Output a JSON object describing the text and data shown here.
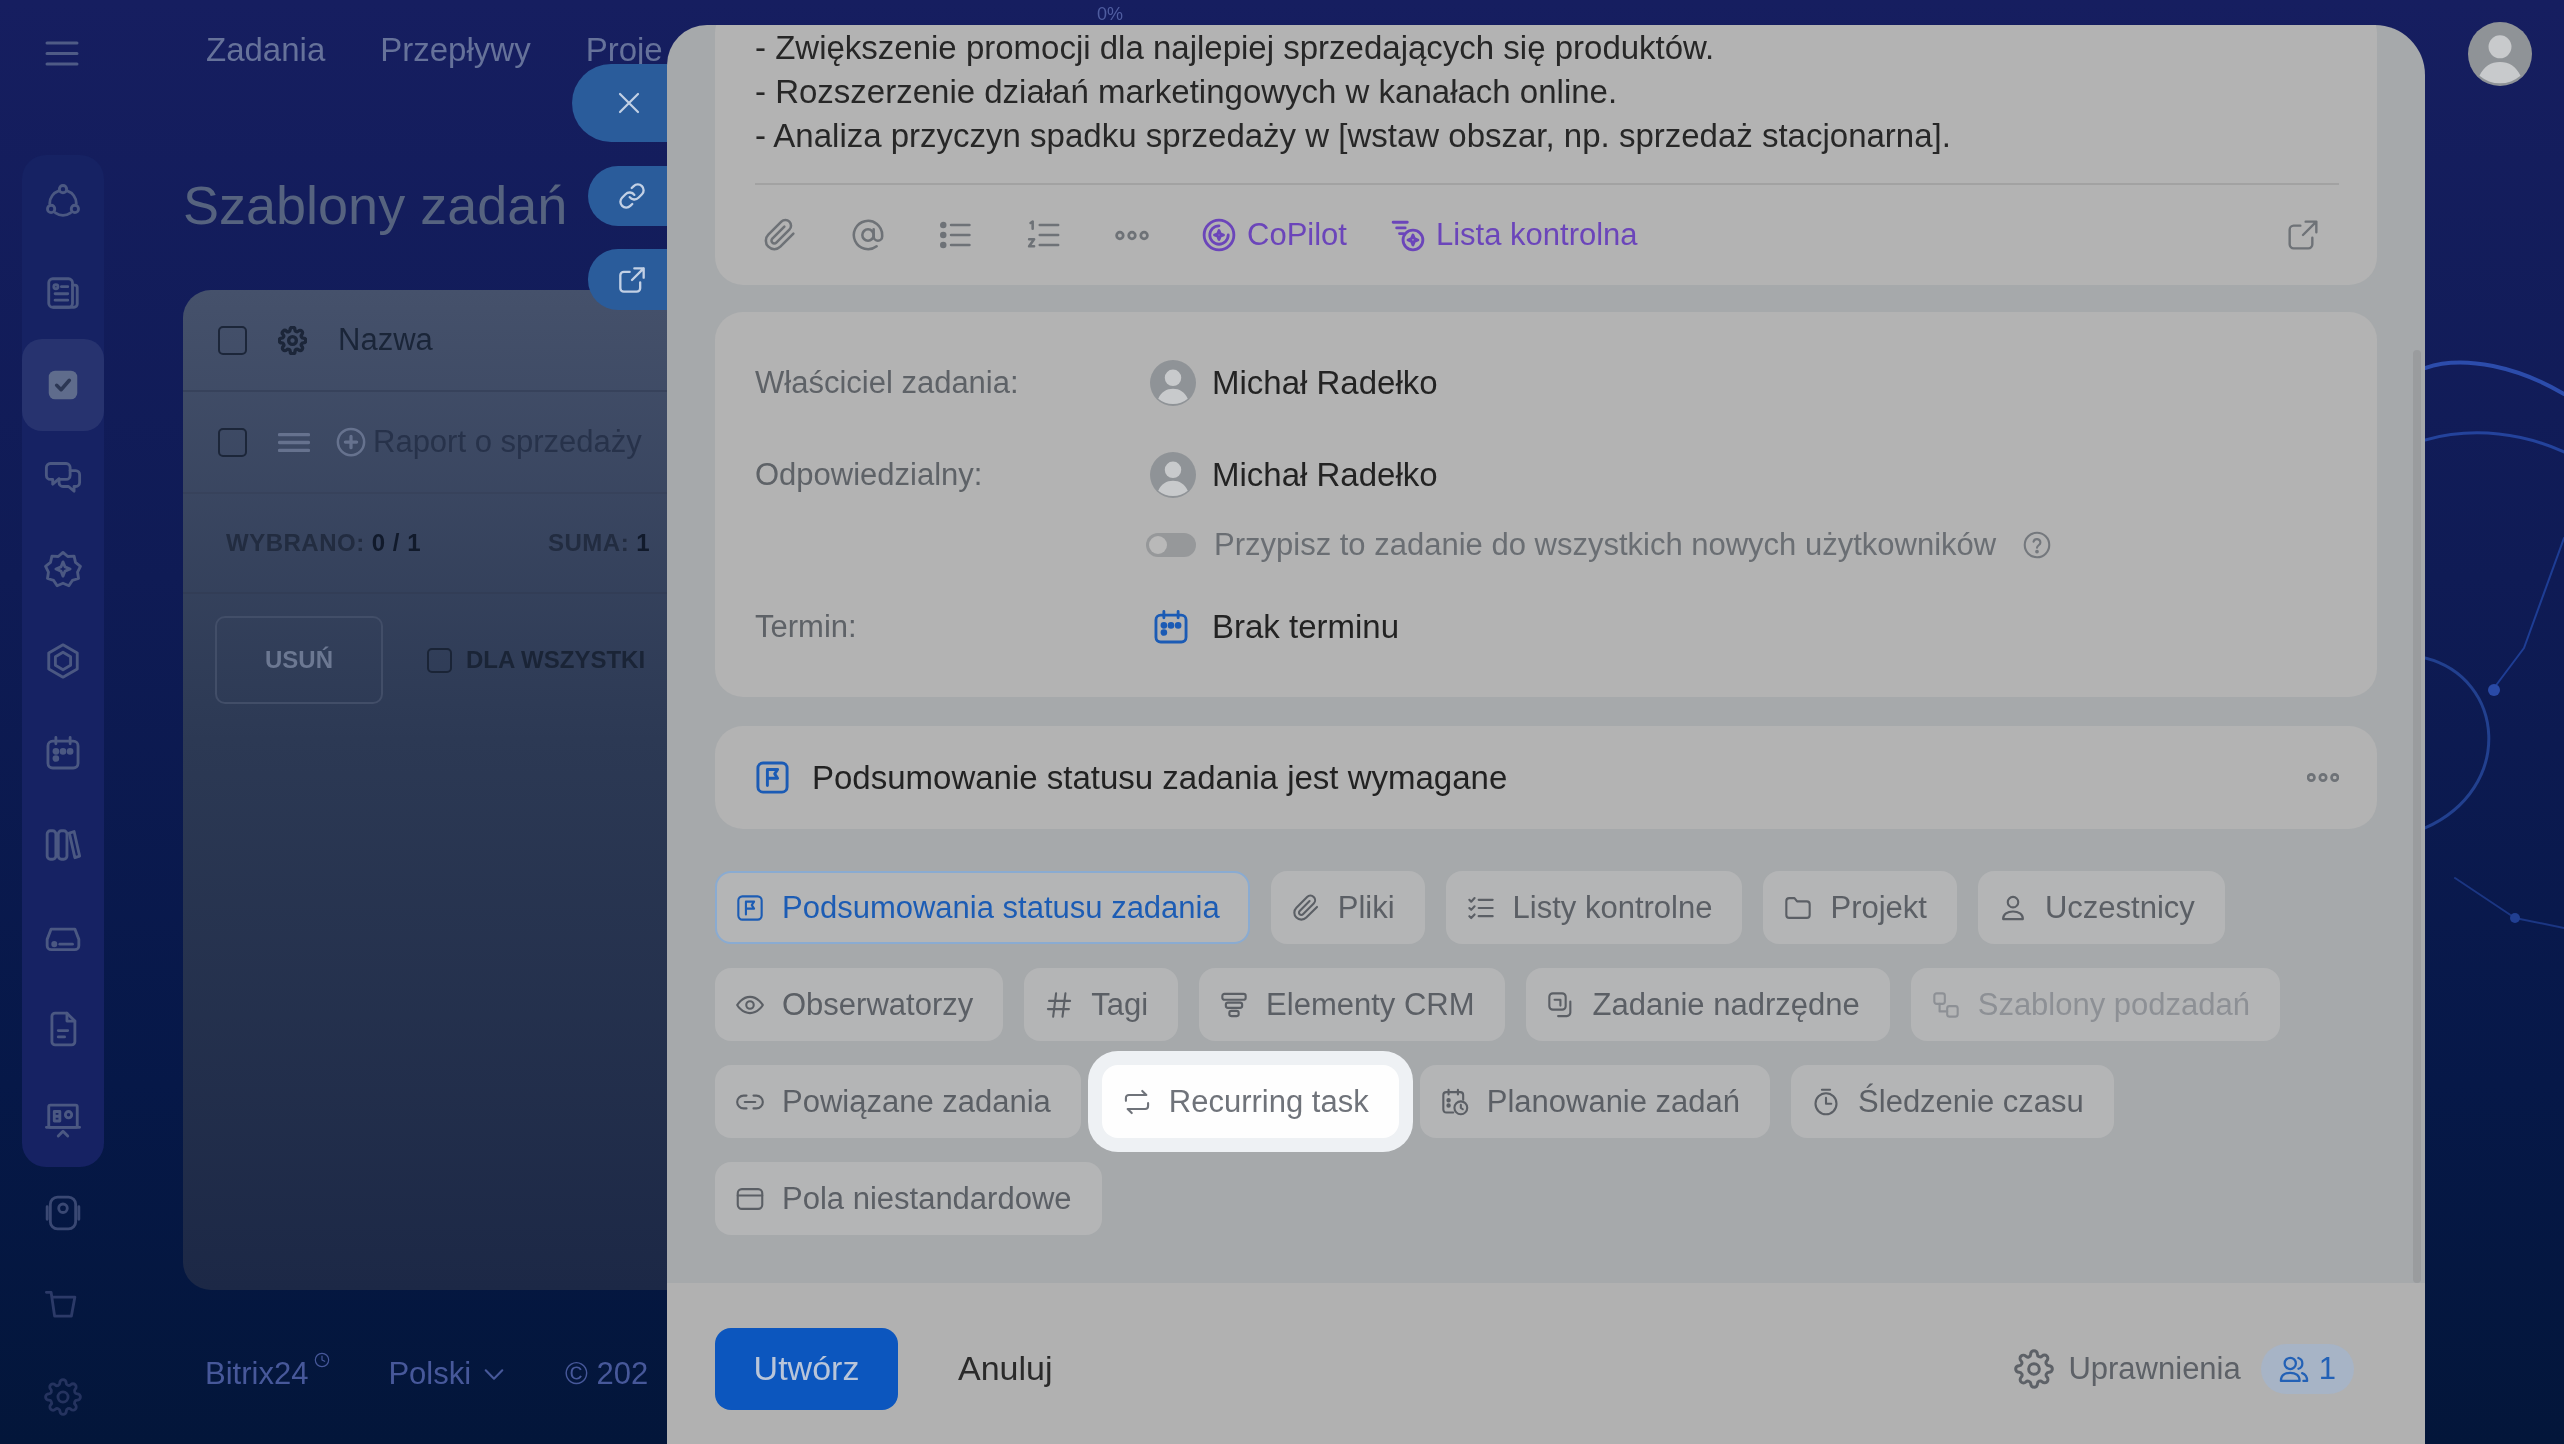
{
  "top_nav": {
    "items": [
      {
        "label": "Zadania"
      },
      {
        "label": "Przepływy"
      },
      {
        "label": "Proje"
      }
    ]
  },
  "sidebar": {
    "items": [
      {
        "selected": false
      },
      {
        "selected": false
      },
      {
        "selected": true
      },
      {
        "selected": false
      },
      {
        "selected": false
      },
      {
        "selected": false
      },
      {
        "selected": false
      },
      {
        "selected": false
      },
      {
        "selected": false
      },
      {
        "selected": false
      },
      {
        "selected": false
      },
      {
        "selected": false
      },
      {
        "selected": false
      },
      {
        "selected": false
      }
    ]
  },
  "page": {
    "title": "Szablony zadań",
    "table": {
      "header_checked": false,
      "column": "Nazwa",
      "rows": [
        {
          "name": "Raport o sprzedaży",
          "checked": false
        }
      ],
      "selected_summary": "WYBRANO: **0 / 1**",
      "total_summary": "SUMA: **1**",
      "delete_button": "USUŃ",
      "for_all_label": "DLA WSZYSTKI",
      "for_all_checked": false
    }
  },
  "footer": {
    "brand": "Bitrix24",
    "language": "Polski",
    "copyright": "© 202"
  },
  "modal": {
    "progress": "0%",
    "description": [
      "- Zwiększenie promocji dla najlepiej sprzedających się produktów.",
      "- Rozszerzenie działań marketingowych w kanałach online.",
      "- Analiza przyczyn spadku sprzedaży w [wstaw obszar, np. sprzedaż stacjonarna]."
    ],
    "toolbar": {
      "copilot": "CoPilot",
      "checklist": "Lista kontrolna"
    },
    "fields": [
      {
        "kind": "person",
        "label": "Właściciel zadania:",
        "value": "Michał Radełko"
      },
      {
        "kind": "person",
        "label": "Odpowiedzialny:",
        "value": "Michał Radełko",
        "toggle": {
          "label": "Przypisz to zadanie do wszystkich nowych użytkowników",
          "on": false
        }
      },
      {
        "kind": "date",
        "label": "Termin:",
        "value": "Brak terminu"
      }
    ],
    "requirement": "Podsumowanie statusu zadania jest wymagane",
    "chips": [
      {
        "label": "Podsumowania statusu zadania",
        "selected": true,
        "disabled": false,
        "highlighted": false
      },
      {
        "label": "Pliki",
        "selected": false,
        "disabled": false,
        "highlighted": false
      },
      {
        "label": "Listy kontrolne",
        "selected": false,
        "disabled": false,
        "highlighted": false
      },
      {
        "label": "Projekt",
        "selected": false,
        "disabled": false,
        "highlighted": false
      },
      {
        "label": "Uczestnicy",
        "selected": false,
        "disabled": false,
        "highlighted": false
      },
      {
        "label": "Obserwatorzy",
        "selected": false,
        "disabled": false,
        "highlighted": false
      },
      {
        "label": "Tagi",
        "selected": false,
        "disabled": false,
        "highlighted": false
      },
      {
        "label": "Elementy CRM",
        "selected": false,
        "disabled": false,
        "highlighted": false
      },
      {
        "label": "Zadanie nadrzędne",
        "selected": false,
        "disabled": false,
        "highlighted": false
      },
      {
        "label": "Szablony podzadań",
        "selected": false,
        "disabled": true,
        "highlighted": false
      },
      {
        "label": "Powiązane zadania",
        "selected": false,
        "disabled": false,
        "highlighted": false
      },
      {
        "label": "Recurring task",
        "selected": false,
        "disabled": false,
        "highlighted": true
      },
      {
        "label": "Planowanie zadań",
        "selected": false,
        "disabled": false,
        "highlighted": false
      },
      {
        "label": "Śledzenie czasu",
        "selected": false,
        "disabled": false,
        "highlighted": false
      },
      {
        "label": "Pola niestandardowe",
        "selected": false,
        "disabled": false,
        "highlighted": false
      }
    ],
    "footer": {
      "create": "Utwórz",
      "cancel": "Anuluj",
      "permissions": "Uprawnienia",
      "members": "1"
    }
  }
}
